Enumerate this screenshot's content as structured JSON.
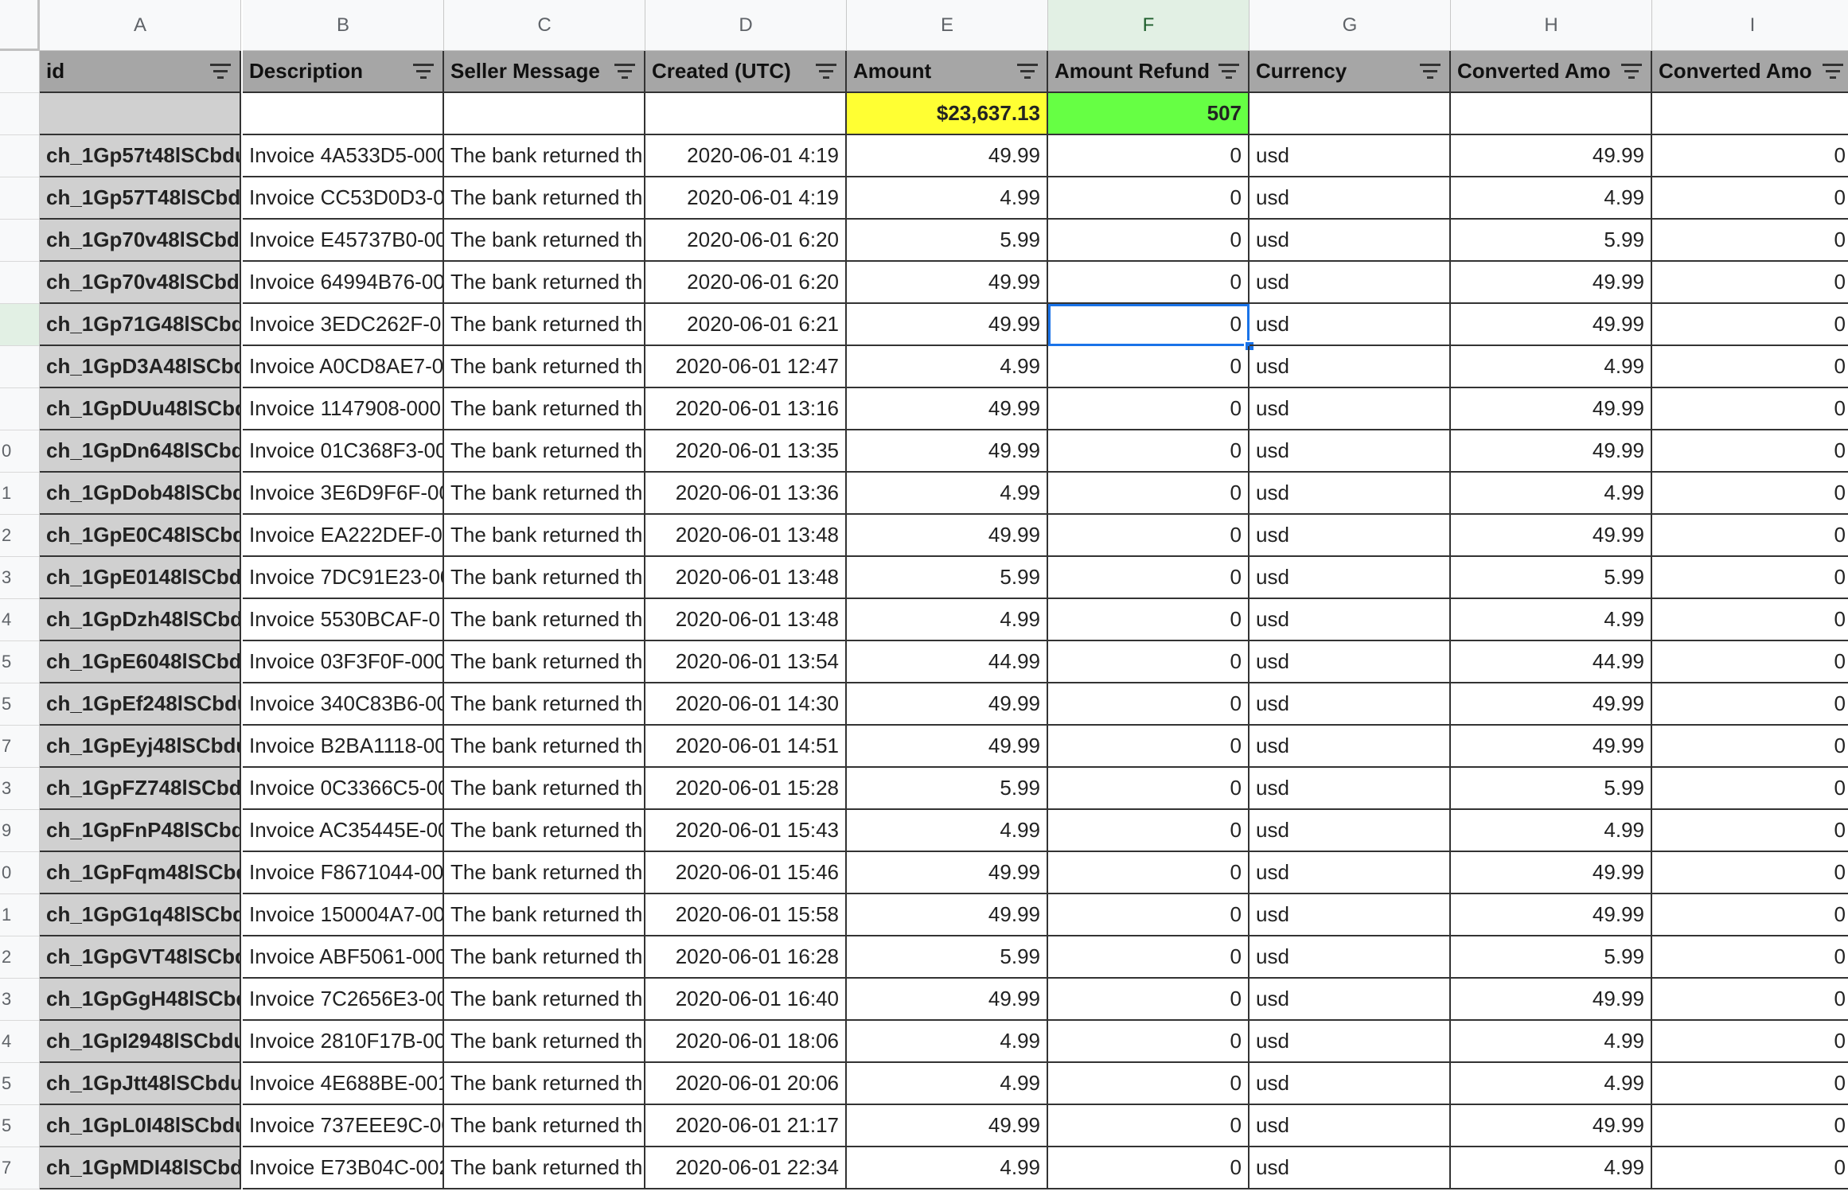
{
  "columns": [
    "A",
    "B",
    "C",
    "D",
    "E",
    "F",
    "G",
    "H",
    "I"
  ],
  "headers": [
    "id",
    "Description",
    "Seller Message",
    "Created (UTC)",
    "Amount",
    "Amount Refund",
    "Currency",
    "Converted Amo",
    "Converted Amo"
  ],
  "summary": {
    "amount": "$23,637.13",
    "refund": "507"
  },
  "rows": [
    {
      "num": "",
      "id": "ch_1Gp57t48lSCbdu",
      "desc": "Invoice 4A533D5-000",
      "msg": "The bank returned th",
      "created": "2020-06-01 4:19",
      "amount": "49.99",
      "refund": "0",
      "currency": "usd",
      "conv": "49.99",
      "conv2": "0"
    },
    {
      "num": "",
      "id": "ch_1Gp57T48lSCbd",
      "desc": "Invoice CC53D0D3-0",
      "msg": "The bank returned th",
      "created": "2020-06-01 4:19",
      "amount": "4.99",
      "refund": "0",
      "currency": "usd",
      "conv": "4.99",
      "conv2": "0"
    },
    {
      "num": "",
      "id": "ch_1Gp70v48lSCbd",
      "desc": "Invoice E45737B0-00",
      "msg": "The bank returned th",
      "created": "2020-06-01 6:20",
      "amount": "5.99",
      "refund": "0",
      "currency": "usd",
      "conv": "5.99",
      "conv2": "0"
    },
    {
      "num": "",
      "id": "ch_1Gp70v48lSCbd",
      "desc": "Invoice 64994B76-00",
      "msg": "The bank returned th",
      "created": "2020-06-01 6:20",
      "amount": "49.99",
      "refund": "0",
      "currency": "usd",
      "conv": "49.99",
      "conv2": "0"
    },
    {
      "num": "",
      "id": "ch_1Gp71G48lSCbd",
      "desc": "Invoice 3EDC262F-0",
      "msg": "The bank returned th",
      "created": "2020-06-01 6:21",
      "amount": "49.99",
      "refund": "0",
      "currency": "usd",
      "conv": "49.99",
      "conv2": "0"
    },
    {
      "num": "",
      "id": "ch_1GpD3A48lSCbd",
      "desc": "Invoice A0CD8AE7-0",
      "msg": "The bank returned th",
      "created": "2020-06-01 12:47",
      "amount": "4.99",
      "refund": "0",
      "currency": "usd",
      "conv": "4.99",
      "conv2": "0"
    },
    {
      "num": "",
      "id": "ch_1GpDUu48lSCbd",
      "desc": "Invoice 1147908-000",
      "msg": "The bank returned th",
      "created": "2020-06-01 13:16",
      "amount": "49.99",
      "refund": "0",
      "currency": "usd",
      "conv": "49.99",
      "conv2": "0"
    },
    {
      "num": "0",
      "id": "ch_1GpDn648lSCbd",
      "desc": "Invoice 01C368F3-00",
      "msg": "The bank returned th",
      "created": "2020-06-01 13:35",
      "amount": "49.99",
      "refund": "0",
      "currency": "usd",
      "conv": "49.99",
      "conv2": "0"
    },
    {
      "num": "1",
      "id": "ch_1GpDob48lSCbd",
      "desc": "Invoice 3E6D9F6F-00",
      "msg": "The bank returned th",
      "created": "2020-06-01 13:36",
      "amount": "4.99",
      "refund": "0",
      "currency": "usd",
      "conv": "4.99",
      "conv2": "0"
    },
    {
      "num": "2",
      "id": "ch_1GpE0C48lSCbd",
      "desc": "Invoice EA222DEF-00",
      "msg": "The bank returned th",
      "created": "2020-06-01 13:48",
      "amount": "49.99",
      "refund": "0",
      "currency": "usd",
      "conv": "49.99",
      "conv2": "0"
    },
    {
      "num": "3",
      "id": "ch_1GpE0148lSCbd",
      "desc": "Invoice 7DC91E23-00",
      "msg": "The bank returned th",
      "created": "2020-06-01 13:48",
      "amount": "5.99",
      "refund": "0",
      "currency": "usd",
      "conv": "5.99",
      "conv2": "0"
    },
    {
      "num": "4",
      "id": "ch_1GpDzh48lSCbd",
      "desc": "Invoice 5530BCAF-0",
      "msg": "The bank returned th",
      "created": "2020-06-01 13:48",
      "amount": "4.99",
      "refund": "0",
      "currency": "usd",
      "conv": "4.99",
      "conv2": "0"
    },
    {
      "num": "5",
      "id": "ch_1GpE6048lSCbd",
      "desc": "Invoice 03F3F0F-000",
      "msg": "The bank returned th",
      "created": "2020-06-01 13:54",
      "amount": "44.99",
      "refund": "0",
      "currency": "usd",
      "conv": "44.99",
      "conv2": "0"
    },
    {
      "num": "5",
      "id": "ch_1GpEf248lSCbdu",
      "desc": "Invoice 340C83B6-00",
      "msg": "The bank returned th",
      "created": "2020-06-01 14:30",
      "amount": "49.99",
      "refund": "0",
      "currency": "usd",
      "conv": "49.99",
      "conv2": "0"
    },
    {
      "num": "7",
      "id": "ch_1GpEyj48lSCbdu",
      "desc": "Invoice B2BA1118-00",
      "msg": "The bank returned th",
      "created": "2020-06-01 14:51",
      "amount": "49.99",
      "refund": "0",
      "currency": "usd",
      "conv": "49.99",
      "conv2": "0"
    },
    {
      "num": "3",
      "id": "ch_1GpFZ748lSCbd",
      "desc": "Invoice 0C3366C5-00",
      "msg": "The bank returned th",
      "created": "2020-06-01 15:28",
      "amount": "5.99",
      "refund": "0",
      "currency": "usd",
      "conv": "5.99",
      "conv2": "0"
    },
    {
      "num": "9",
      "id": "ch_1GpFnP48lSCbd",
      "desc": "Invoice AC35445E-00",
      "msg": "The bank returned th",
      "created": "2020-06-01 15:43",
      "amount": "4.99",
      "refund": "0",
      "currency": "usd",
      "conv": "4.99",
      "conv2": "0"
    },
    {
      "num": "0",
      "id": "ch_1GpFqm48lSCbd",
      "desc": "Invoice F8671044-00",
      "msg": "The bank returned th",
      "created": "2020-06-01 15:46",
      "amount": "49.99",
      "refund": "0",
      "currency": "usd",
      "conv": "49.99",
      "conv2": "0"
    },
    {
      "num": "1",
      "id": "ch_1GpG1q48lSCbd",
      "desc": "Invoice 150004A7-00",
      "msg": "The bank returned th",
      "created": "2020-06-01 15:58",
      "amount": "49.99",
      "refund": "0",
      "currency": "usd",
      "conv": "49.99",
      "conv2": "0"
    },
    {
      "num": "2",
      "id": "ch_1GpGVT48lSCbd",
      "desc": "Invoice ABF5061-000",
      "msg": "The bank returned th",
      "created": "2020-06-01 16:28",
      "amount": "5.99",
      "refund": "0",
      "currency": "usd",
      "conv": "5.99",
      "conv2": "0"
    },
    {
      "num": "3",
      "id": "ch_1GpGgH48lSCbd",
      "desc": "Invoice 7C2656E3-00",
      "msg": "The bank returned th",
      "created": "2020-06-01 16:40",
      "amount": "49.99",
      "refund": "0",
      "currency": "usd",
      "conv": "49.99",
      "conv2": "0"
    },
    {
      "num": "4",
      "id": "ch_1GpI2948lSCbdu",
      "desc": "Invoice 2810F17B-00",
      "msg": "The bank returned th",
      "created": "2020-06-01 18:06",
      "amount": "4.99",
      "refund": "0",
      "currency": "usd",
      "conv": "4.99",
      "conv2": "0"
    },
    {
      "num": "5",
      "id": "ch_1GpJtt48lSCbdu",
      "desc": "Invoice 4E688BE-001",
      "msg": "The bank returned th",
      "created": "2020-06-01 20:06",
      "amount": "4.99",
      "refund": "0",
      "currency": "usd",
      "conv": "4.99",
      "conv2": "0"
    },
    {
      "num": "5",
      "id": "ch_1GpL0I48lSCbdu",
      "desc": "Invoice 737EEE9C-00",
      "msg": "The bank returned th",
      "created": "2020-06-01 21:17",
      "amount": "49.99",
      "refund": "0",
      "currency": "usd",
      "conv": "49.99",
      "conv2": "0"
    },
    {
      "num": "7",
      "id": "ch_1GpMDI48lSCbd",
      "desc": "Invoice E73B04C-002",
      "msg": "The bank returned th",
      "created": "2020-06-01 22:34",
      "amount": "4.99",
      "refund": "0",
      "currency": "usd",
      "conv": "4.99",
      "conv2": "0"
    }
  ],
  "selection": {
    "row_index": 4,
    "column": "F"
  },
  "colors": {
    "summary_amount_bg": "#ffff33",
    "summary_refund_bg": "#66ff44",
    "header_bg": "#a6a6a6",
    "id_col_bg": "#d0d0d0",
    "selection": "#1a73e8"
  }
}
